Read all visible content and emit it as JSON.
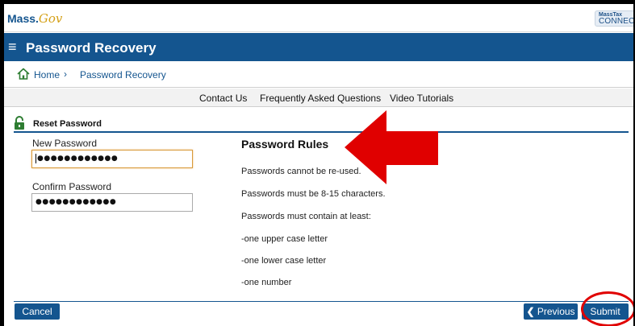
{
  "header": {
    "mass_logo": "Mass.",
    "mass_logo_gov": "Gov",
    "masstax_logo_line1": "MassTax",
    "masstax_logo_line2": "CONNECT"
  },
  "title_bar": {
    "menu_icon": "hamburger-menu-icon",
    "title": "Password Recovery"
  },
  "breadcrumb": {
    "home_icon": "home-icon",
    "home": "Home",
    "separator": "›",
    "current": "Password Recovery"
  },
  "links": [
    "Contact Us",
    "Frequently Asked Questions",
    "Video Tutorials"
  ],
  "section": {
    "icon": "lock-icon",
    "title": "Reset Password"
  },
  "form": {
    "new_password_label": "New Password",
    "new_password_value": "●●●●●●●●●●●●",
    "confirm_password_label": "Confirm Password",
    "confirm_password_value": "●●●●●●●●●●●●"
  },
  "rules": {
    "title": "Password Rules",
    "items": [
      "Passwords cannot be re-used.",
      "Passwords must be 8-15 characters.",
      "Passwords must contain at least:",
      "-one upper case letter",
      "-one lower case letter",
      "-one number"
    ]
  },
  "footer": {
    "cancel": "Cancel",
    "previous": "Previous",
    "previous_icon": "chevron-left-icon",
    "submit": "Submit"
  },
  "colors": {
    "brand_blue": "#14558f",
    "annotation_red": "#e00000"
  }
}
